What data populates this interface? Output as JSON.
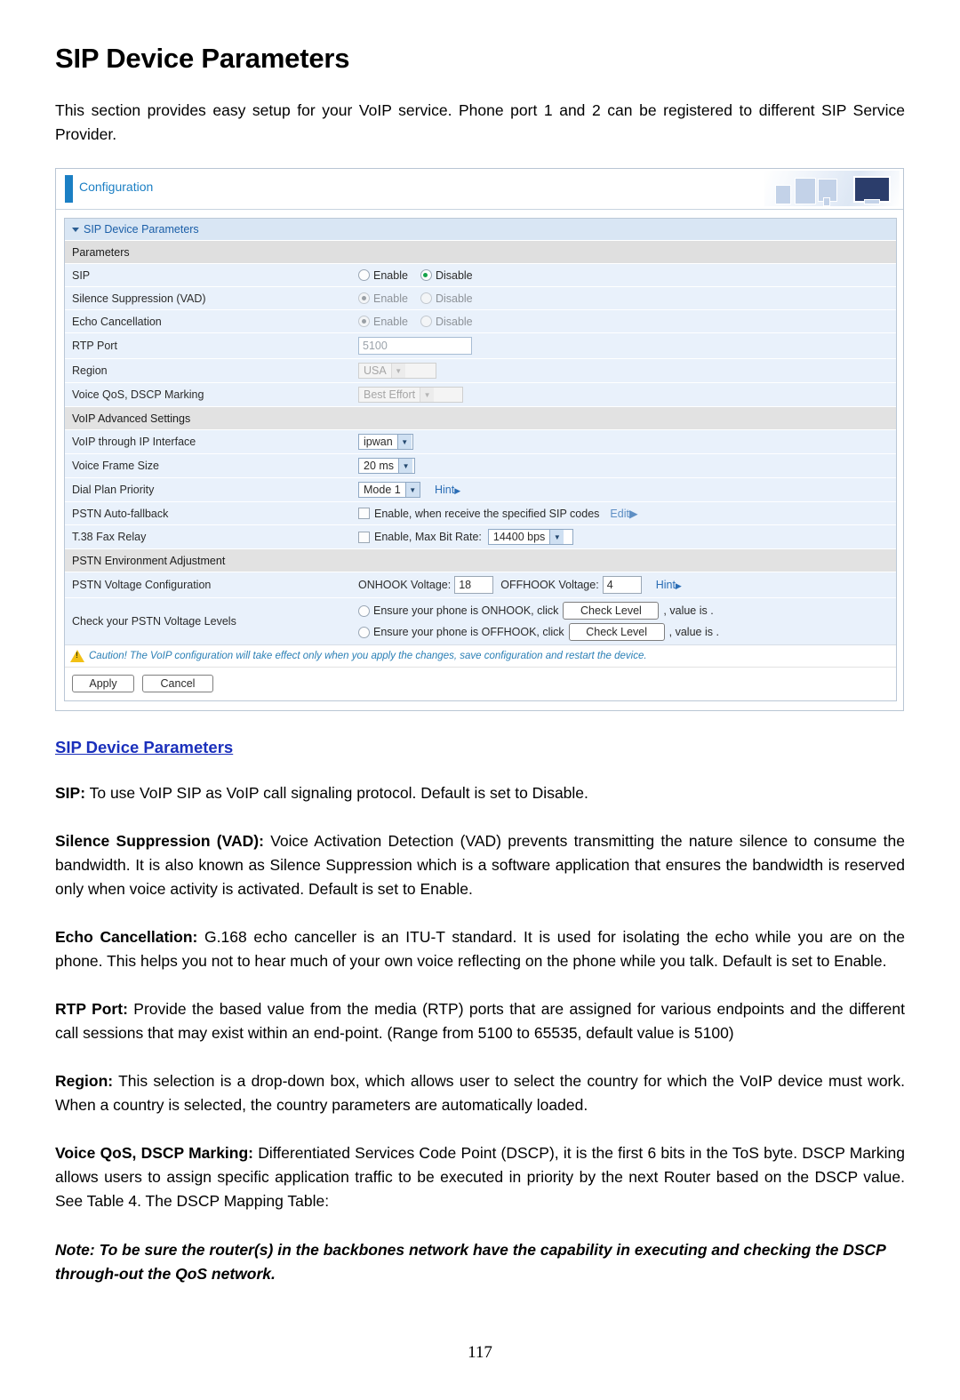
{
  "document": {
    "title": "SIP Device Parameters",
    "intro": "This section provides easy setup for your VoIP service. Phone port 1 and 2 can be registered to different SIP Service Provider.",
    "section_link": "SIP Device Parameters",
    "page_number": "117",
    "paragraphs": [
      {
        "lead": "SIP:",
        "text": " To use VoIP SIP as VoIP call signaling protocol. Default is set to Disable."
      },
      {
        "lead": "Silence Suppression (VAD):",
        "text": " Voice Activation Detection (VAD) prevents transmitting the nature silence to consume the bandwidth. It is also known as Silence Suppression which is a software application that ensures the bandwidth is reserved only when voice activity is activated.  Default is set to Enable."
      },
      {
        "lead": "Echo Cancellation:",
        "text": " G.168 echo canceller is an ITU-T standard.  It is used for isolating the echo while you are on the phone. This helps you not to hear much of your own voice reflecting on the phone while you talk. Default is set to Enable."
      },
      {
        "lead": "RTP Port:",
        "text": " Provide the based value from the media (RTP) ports that are assigned for various endpoints and the different call sessions that may exist within an end-point. (Range from 5100 to 65535, default value is 5100)"
      },
      {
        "lead": "Region:",
        "text": " This selection is a drop-down box, which allows user to select the country for which the VoIP device must work. When a country is selected, the country parameters are automatically loaded."
      },
      {
        "lead": "Voice QoS, DSCP Marking:",
        "text": " Differentiated Services Code Point (DSCP), it is the first 6 bits in the ToS byte. DSCP Marking allows users to assign specific application traffic to be executed in priority by the next Router based on the DSCP value.  See Table 4. The DSCP Mapping Table:"
      }
    ],
    "note": "Note: To be sure the router(s) in the backbones network have the capability in executing and checking the DSCP through-out the QoS network."
  },
  "screenshot": {
    "header": {
      "title": "Configuration"
    },
    "panel": {
      "titlebar": "SIP Device Parameters",
      "section_parameters": "Parameters",
      "section_advanced": "VoIP Advanced Settings",
      "section_pstn": "PSTN Environment Adjustment",
      "rows": {
        "sip": {
          "label": "SIP",
          "enable_label": "Enable",
          "disable_label": "Disable",
          "selected": "Disable"
        },
        "vad": {
          "label": "Silence Suppression (VAD)",
          "enable_label": "Enable",
          "disable_label": "Disable",
          "selected": "Enable"
        },
        "echo": {
          "label": "Echo Cancellation",
          "enable_label": "Enable",
          "disable_label": "Disable",
          "selected": "Enable"
        },
        "rtp_port": {
          "label": "RTP Port",
          "value": "5100"
        },
        "region": {
          "label": "Region",
          "value": "USA"
        },
        "dscp": {
          "label": "Voice QoS, DSCP Marking",
          "value": "Best Effort"
        },
        "ip_interface": {
          "label": "VoIP through IP Interface",
          "value": "ipwan"
        },
        "frame_size": {
          "label": "Voice Frame Size",
          "value": "20 ms"
        },
        "dial_plan": {
          "label": "Dial Plan Priority",
          "value": "Mode 1",
          "hint": "Hint"
        },
        "pstn_fallback": {
          "label": "PSTN Auto-fallback",
          "checkbox_label": "Enable, when receive the specified SIP codes",
          "edit_link": "Edit"
        },
        "fax_relay": {
          "label": "T.38 Fax Relay",
          "checkbox_label": "Enable, Max Bit Rate:",
          "value": "14400 bps"
        },
        "pstn_voltage": {
          "label": "PSTN Voltage Configuration",
          "onhook_label": "ONHOOK Voltage:",
          "onhook_value": "18",
          "offhook_label": "OFFHOOK Voltage:",
          "offhook_value": "4",
          "hint": "Hint"
        },
        "check_levels": {
          "label": "Check your PSTN Voltage Levels",
          "onhook_prefix": "Ensure your phone is ONHOOK, click",
          "offhook_prefix": "Ensure your phone is OFFHOOK, click",
          "button_label": "Check Level",
          "suffix": ", value is  ."
        }
      },
      "caution": "Caution! The VoIP configuration will take effect only when you apply the changes, save configuration and restart the device.",
      "apply_label": "Apply",
      "cancel_label": "Cancel"
    }
  }
}
